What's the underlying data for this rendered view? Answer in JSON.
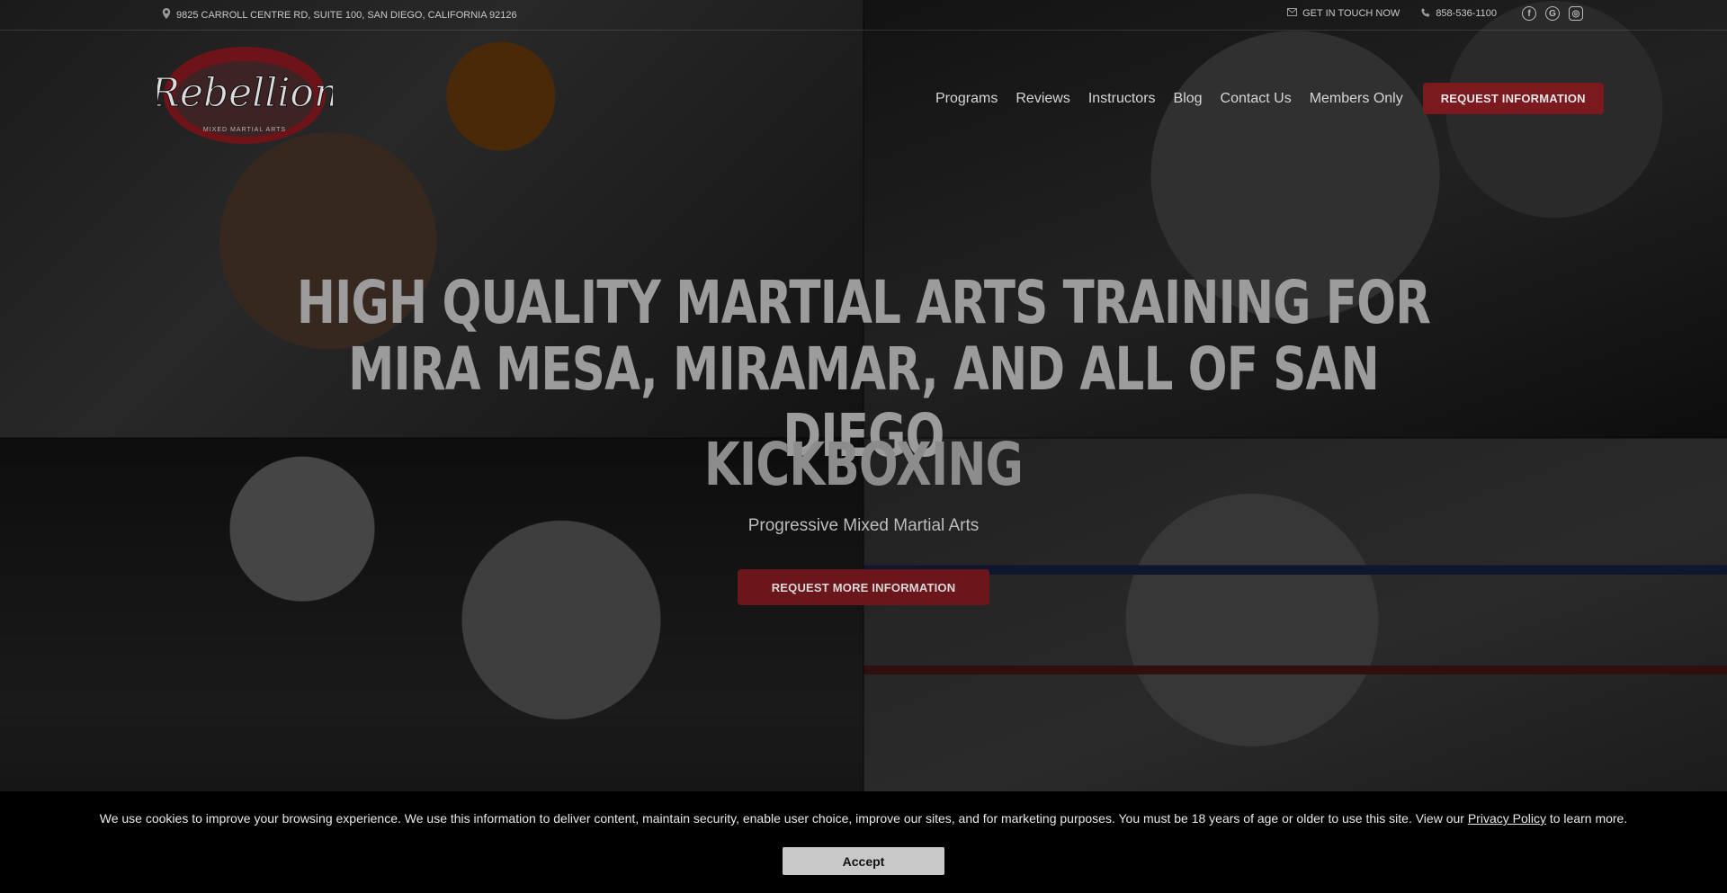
{
  "topbar": {
    "address": "9825 CARROLL CENTRE RD, SUITE 100, SAN DIEGO, CALIFORNIA 92126",
    "contact_label": "GET IN TOUCH NOW",
    "phone": "858-536-1100",
    "socials": [
      "facebook-icon",
      "google-icon",
      "instagram-icon"
    ]
  },
  "logo": {
    "text": "Rebellion",
    "tagline": "MIXED MARTIAL ARTS"
  },
  "nav": {
    "items": [
      "Programs",
      "Reviews",
      "Instructors",
      "Blog",
      "Contact Us",
      "Members Only"
    ],
    "cta": "REQUEST INFORMATION"
  },
  "hero": {
    "title": "HIGH QUALITY MARTIAL ARTS TRAINING FOR MIRA MESA, MIRAMAR, AND ALL OF SAN DIEGO",
    "program": "KICKBOXING",
    "tagline": "Progressive Mixed Martial Arts",
    "cta": "REQUEST MORE INFORMATION"
  },
  "cookie": {
    "text_before": "We use cookies to improve your browsing experience. We use this information to deliver content, maintain security, enable user choice, improve our sites, and for marketing purposes. You must be 18 years of age or older to use this site. View our ",
    "link": "Privacy Policy",
    "text_after": " to learn more.",
    "accept": "Accept"
  },
  "colors": {
    "brand_red": "#7a1a1f",
    "overlay": "#000000"
  }
}
